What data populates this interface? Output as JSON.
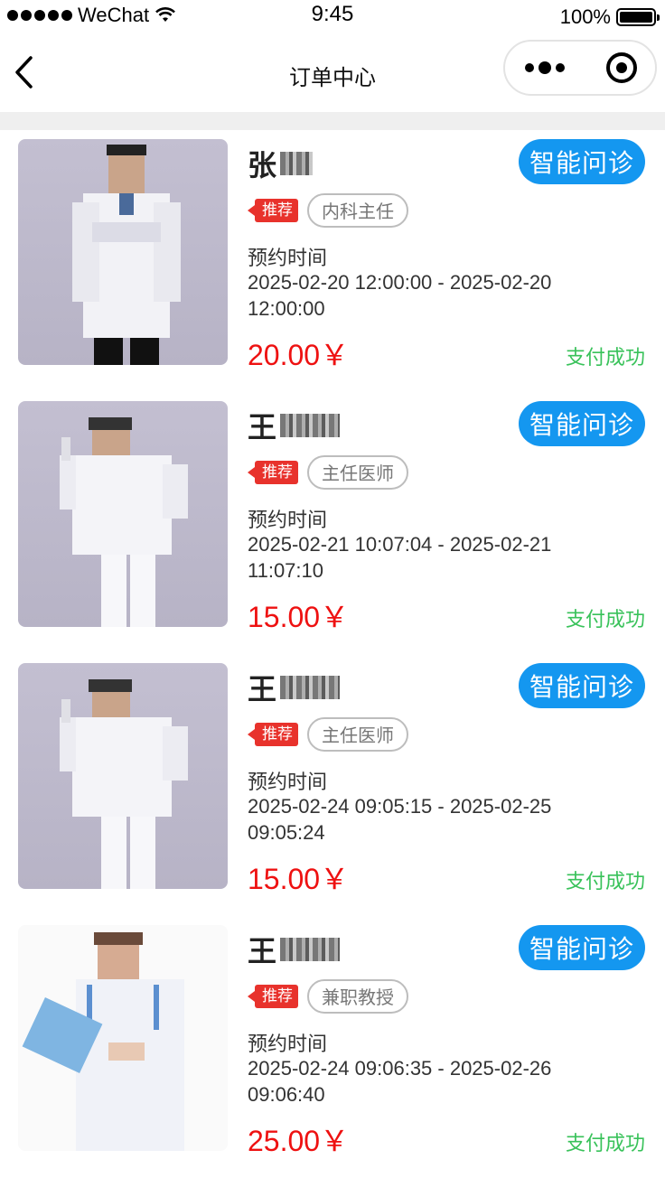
{
  "status_bar": {
    "carrier": "WeChat",
    "time": "9:45",
    "battery": "100%"
  },
  "nav": {
    "title": "订单中心"
  },
  "orders": [
    {
      "name_visible": "张",
      "consult_label": "智能问诊",
      "recommend_label": "推荐",
      "title_tag": "内科主任",
      "appointment_label": "预约时间",
      "appointment_time": "2025-02-20 12:00:00 - 2025-02-20 12:00:00",
      "price": "20.00￥",
      "status": "支付成功"
    },
    {
      "name_visible": "王",
      "consult_label": "智能问诊",
      "recommend_label": "推荐",
      "title_tag": "主任医师",
      "appointment_label": "预约时间",
      "appointment_time": "2025-02-21 10:07:04 - 2025-02-21 11:07:10",
      "price": "15.00￥",
      "status": "支付成功"
    },
    {
      "name_visible": "王",
      "consult_label": "智能问诊",
      "recommend_label": "推荐",
      "title_tag": "主任医师",
      "appointment_label": "预约时间",
      "appointment_time": "2025-02-24 09:05:15 - 2025-02-25 09:05:24",
      "price": "15.00￥",
      "status": "支付成功"
    },
    {
      "name_visible": "王",
      "consult_label": "智能问诊",
      "recommend_label": "推荐",
      "title_tag": "兼职教授",
      "appointment_label": "预约时间",
      "appointment_time": "2025-02-24 09:06:35 - 2025-02-26 09:06:40",
      "price": "25.00￥",
      "status": "支付成功"
    }
  ],
  "colors": {
    "consult_button": "#1497f0",
    "price": "#ee1111",
    "status_success": "#39c25a",
    "recommend_tag": "#e8322c"
  }
}
